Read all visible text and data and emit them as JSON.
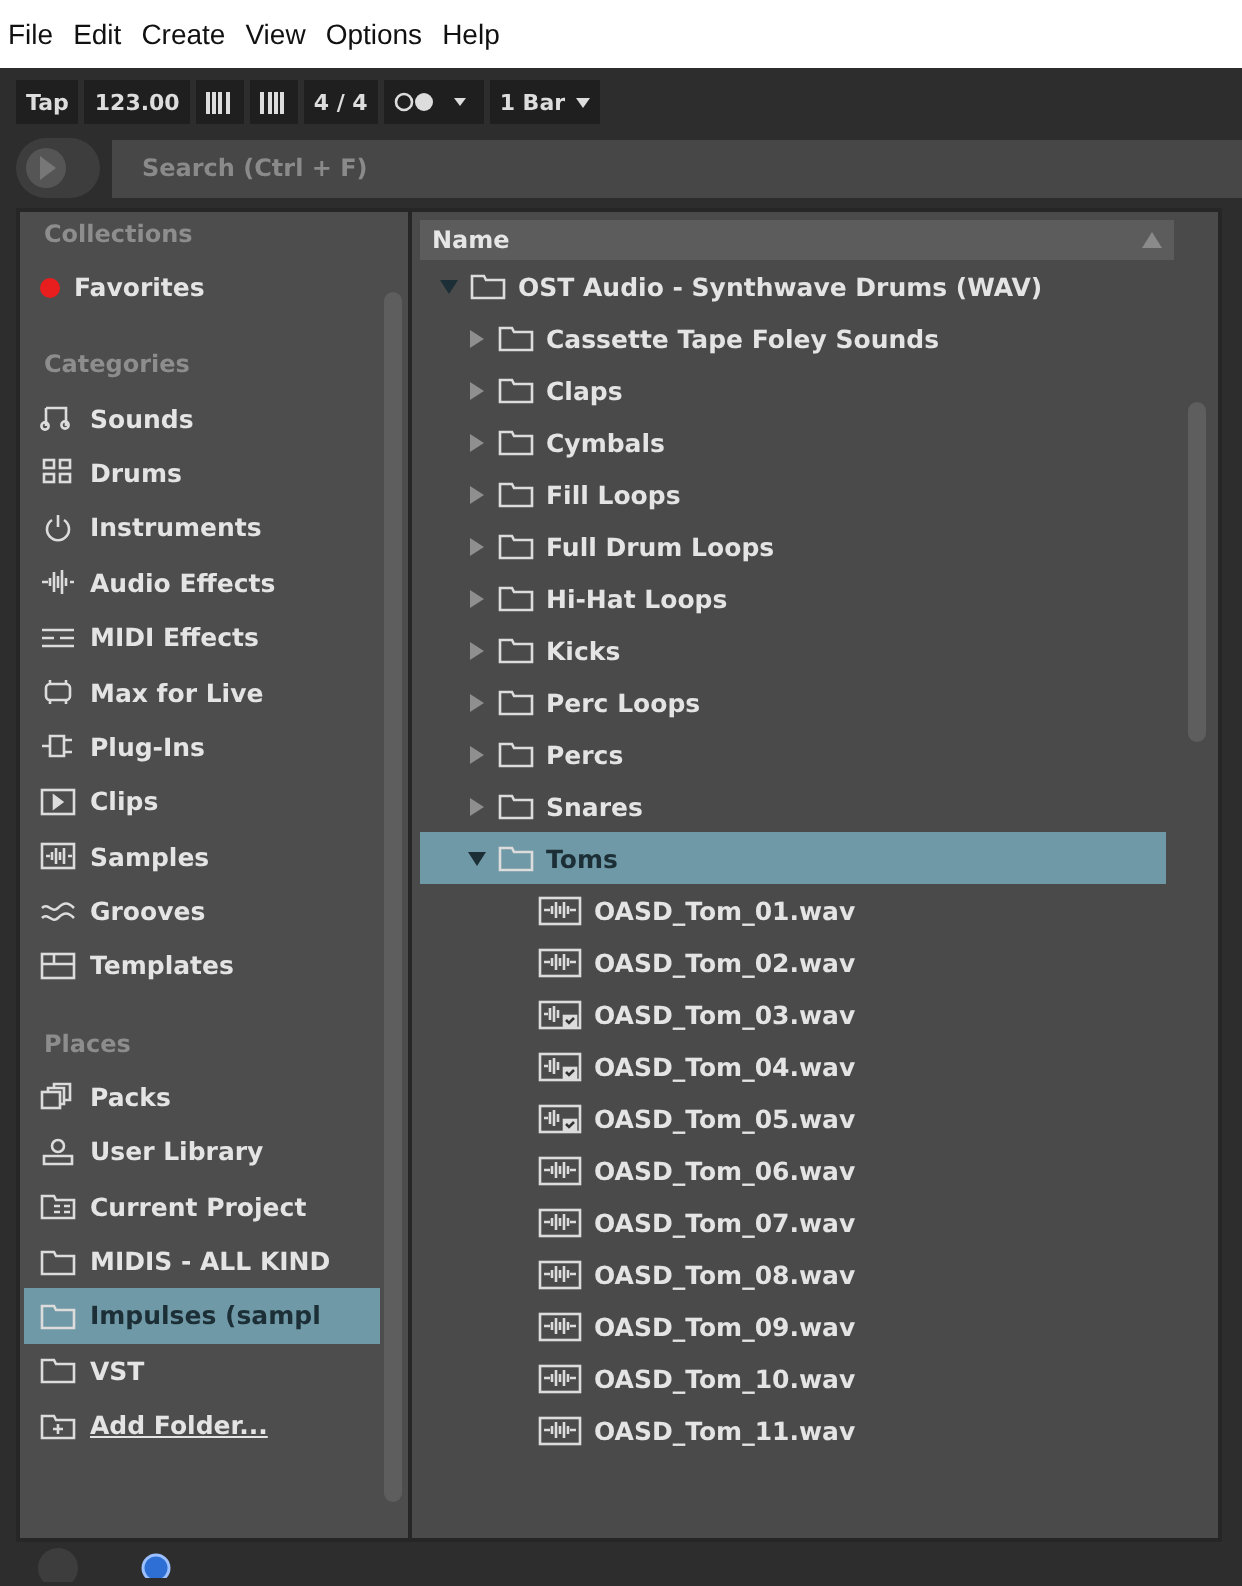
{
  "menu": [
    "File",
    "Edit",
    "Create",
    "View",
    "Options",
    "Help"
  ],
  "toolbar": {
    "tap": "Tap",
    "tempo": "123.00",
    "signature": "4 / 4",
    "quantize": "1 Bar"
  },
  "search": {
    "placeholder": "Search (Ctrl + F)"
  },
  "sidebar": [
    {
      "title": "Collections",
      "items": [
        {
          "label": "Favorites",
          "kind": "tag",
          "color": "#e81e1e",
          "selected": false
        }
      ]
    },
    {
      "title": "Categories",
      "items": [
        {
          "label": "Sounds",
          "kind": "note",
          "selected": false
        },
        {
          "label": "Drums",
          "kind": "grid",
          "selected": false
        },
        {
          "label": "Instruments",
          "kind": "power",
          "selected": false
        },
        {
          "label": "Audio Effects",
          "kind": "wave",
          "selected": false
        },
        {
          "label": "MIDI Effects",
          "kind": "midi",
          "selected": false
        },
        {
          "label": "Max for Live",
          "kind": "max",
          "selected": false
        },
        {
          "label": "Plug-Ins",
          "kind": "plug",
          "selected": false
        },
        {
          "label": "Clips",
          "kind": "clip",
          "selected": false
        },
        {
          "label": "Samples",
          "kind": "sample",
          "selected": false
        },
        {
          "label": "Grooves",
          "kind": "groove",
          "selected": false
        },
        {
          "label": "Templates",
          "kind": "template",
          "selected": false
        }
      ]
    },
    {
      "title": "Places",
      "items": [
        {
          "label": "Packs",
          "kind": "packs",
          "selected": false
        },
        {
          "label": "User Library",
          "kind": "user",
          "selected": false
        },
        {
          "label": "Current Project",
          "kind": "project",
          "selected": false
        },
        {
          "label": "MIDIS - ALL KIND",
          "kind": "folder",
          "selected": false
        },
        {
          "label": "Impulses (sampl",
          "kind": "folder",
          "selected": true
        },
        {
          "label": "VST",
          "kind": "folder",
          "selected": false
        },
        {
          "label": "Add Folder...",
          "kind": "add",
          "selected": false
        }
      ]
    }
  ],
  "browser": {
    "column": "Name",
    "rows": [
      {
        "label": "OST Audio - Synthwave Drums (WAV)",
        "kind": "folder",
        "expanded": true,
        "selected": false,
        "children": [
          {
            "label": "Cassette Tape Foley Sounds",
            "kind": "folder",
            "expanded": false,
            "selected": false
          },
          {
            "label": "Claps",
            "kind": "folder",
            "expanded": false,
            "selected": false
          },
          {
            "label": "Cymbals",
            "kind": "folder",
            "expanded": false,
            "selected": false
          },
          {
            "label": "Fill Loops",
            "kind": "folder",
            "expanded": false,
            "selected": false
          },
          {
            "label": "Full Drum Loops",
            "kind": "folder",
            "expanded": false,
            "selected": false
          },
          {
            "label": "Hi-Hat Loops",
            "kind": "folder",
            "expanded": false,
            "selected": false
          },
          {
            "label": "Kicks",
            "kind": "folder",
            "expanded": false,
            "selected": false
          },
          {
            "label": "Perc Loops",
            "kind": "folder",
            "expanded": false,
            "selected": false
          },
          {
            "label": "Percs",
            "kind": "folder",
            "expanded": false,
            "selected": false
          },
          {
            "label": "Snares",
            "kind": "folder",
            "expanded": false,
            "selected": false
          },
          {
            "label": "Toms",
            "kind": "folder",
            "expanded": true,
            "selected": true,
            "children": [
              {
                "label": "OASD_Tom_01.wav",
                "kind": "file",
                "analyzed": false,
                "selected": false
              },
              {
                "label": "OASD_Tom_02.wav",
                "kind": "file",
                "analyzed": false,
                "selected": false
              },
              {
                "label": "OASD_Tom_03.wav",
                "kind": "file",
                "analyzed": true,
                "selected": false
              },
              {
                "label": "OASD_Tom_04.wav",
                "kind": "file",
                "analyzed": true,
                "selected": false
              },
              {
                "label": "OASD_Tom_05.wav",
                "kind": "file",
                "analyzed": true,
                "selected": false
              },
              {
                "label": "OASD_Tom_06.wav",
                "kind": "file",
                "analyzed": false,
                "selected": false
              },
              {
                "label": "OASD_Tom_07.wav",
                "kind": "file",
                "analyzed": false,
                "selected": false
              },
              {
                "label": "OASD_Tom_08.wav",
                "kind": "file",
                "analyzed": false,
                "selected": false
              },
              {
                "label": "OASD_Tom_09.wav",
                "kind": "file",
                "analyzed": false,
                "selected": false
              },
              {
                "label": "OASD_Tom_10.wav",
                "kind": "file",
                "analyzed": false,
                "selected": false
              },
              {
                "label": "OASD_Tom_11.wav",
                "kind": "file",
                "analyzed": false,
                "selected": false
              }
            ]
          }
        ]
      }
    ]
  }
}
